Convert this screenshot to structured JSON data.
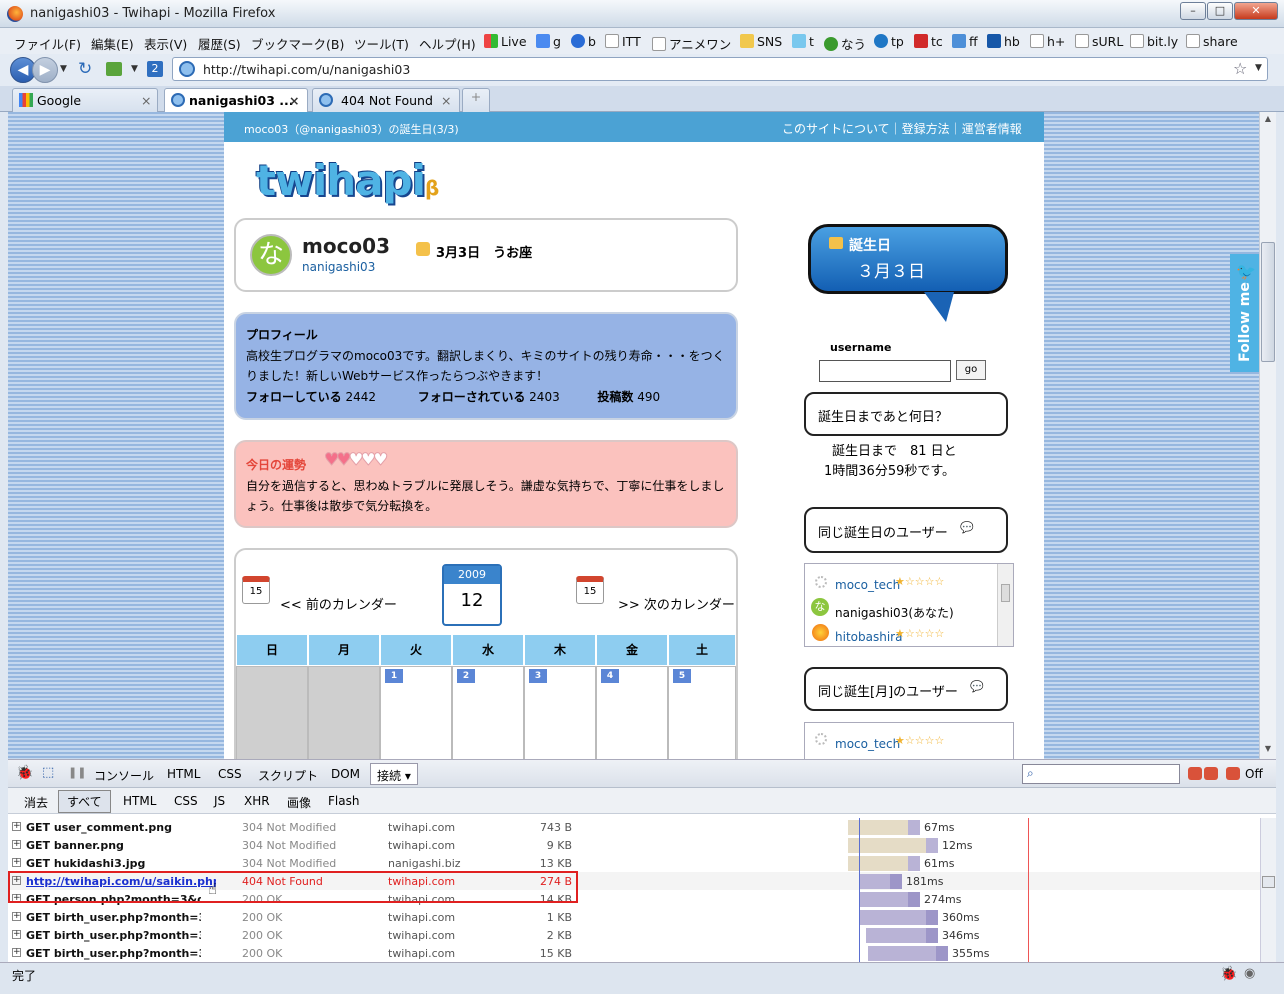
{
  "window": {
    "title": "nanigashi03 - Twihapi - Mozilla Firefox"
  },
  "menu": [
    "ファイル(F)",
    "編集(E)",
    "表示(V)",
    "履歴(S)",
    "ブックマーク(B)",
    "ツール(T)",
    "ヘルプ(H)"
  ],
  "bookmarks": [
    "Live",
    "g",
    "b",
    "ITT",
    "アニメワン",
    "SNS",
    "t",
    "なう",
    "tp",
    "tc",
    "ff",
    "hb",
    "h+",
    "sURL",
    "bit.ly",
    "share"
  ],
  "nav": {
    "url": "http://twihapi.com/u/nanigashi03"
  },
  "tabs": [
    {
      "label": "Google",
      "close": "×"
    },
    {
      "label": "nanigashi03 ...",
      "close": "×"
    },
    {
      "label": "404 Not Found",
      "close": "×"
    }
  ],
  "page": {
    "header_left": "moco03（@nanigashi03）の誕生日(3/3)",
    "header_links": [
      "このサイトについて",
      "登録方法",
      "運営者情報"
    ],
    "logo": "twihapi",
    "logo_beta": "β",
    "user": {
      "name": "moco03",
      "handle": "nanigashi03",
      "avatar_char": "な",
      "birthday": "3月3日",
      "sign": "うお座"
    },
    "profile": {
      "heading": "プロフィール",
      "text": "高校生プログラマのmoco03です。翻訳しまくり、キミのサイトの残り寿命・・・をつくりました！新しいWebサービス作ったらつぶやきます！",
      "following_label": "フォローしている",
      "following": "2442",
      "followers_label": "フォローされている",
      "followers": "2403",
      "posts_label": "投稿数",
      "posts": "490"
    },
    "fortune": {
      "heading": "今日の運勢",
      "hearts_filled": 2,
      "hearts_total": 5,
      "text": "自分を過信すると、思わぬトラブルに発展しそう。謙虚な気持ちで、丁寧に仕事をしましょう。仕事後は散歩で気分転換を。"
    },
    "calendar": {
      "year": "2009",
      "month": "12",
      "prev_icon": "15",
      "next_icon": "15",
      "prev": "<< 前のカレンダー",
      "next": ">> 次のカレンダー",
      "weekdays": [
        "日",
        "月",
        "火",
        "水",
        "木",
        "金",
        "土"
      ],
      "days": [
        "1",
        "2",
        "3",
        "4",
        "5"
      ]
    },
    "sidebar": {
      "bubble_title": "誕生日",
      "bubble_date": "３月３日",
      "username_label": "username",
      "go": "go",
      "days_left_title": "誕生日まであと何日？",
      "days_left_line1": "誕生日まで　81 日と",
      "days_left_line2": "1時間36分59秒です。",
      "same_day_title": "同じ誕生日のユーザー",
      "same_day_users": [
        "moco_tech",
        "nanigashi03(あなた)",
        "hitobashira"
      ],
      "same_month_title": "同じ誕生[月]のユーザー",
      "same_month_users": [
        "moco_tech"
      ],
      "follow_me": "Follow me"
    }
  },
  "firebug": {
    "tabs": [
      "コンソール",
      "HTML",
      "CSS",
      "スクリプト",
      "DOM",
      "接続 ▾"
    ],
    "filters": [
      "消去",
      "すべて",
      "HTML",
      "CSS",
      "JS",
      "XHR",
      "画像",
      "Flash"
    ],
    "off": "Off",
    "rows": [
      {
        "req": "GET user_comment.png",
        "status": "304 Not Modified",
        "domain": "twihapi.com",
        "size": "743 B",
        "time": "67ms"
      },
      {
        "req": "GET banner.png",
        "status": "304 Not Modified",
        "domain": "twihapi.com",
        "size": "9 KB",
        "time": "12ms"
      },
      {
        "req": "GET hukidashi3.jpg",
        "status": "304 Not Modified",
        "domain": "nanigashi.biz",
        "size": "13 KB",
        "time": "61ms"
      },
      {
        "req": "http://twihapi.com/u/saikin.php",
        "status": "404 Not Found",
        "domain": "twihapi.com",
        "size": "274 B",
        "time": "181ms"
      },
      {
        "req": "GET person.php?month=3&da",
        "status": "200 OK",
        "domain": "twihapi.com",
        "size": "14 KB",
        "time": "274ms"
      },
      {
        "req": "GET birth_user.php?month=3&",
        "status": "200 OK",
        "domain": "twihapi.com",
        "size": "1 KB",
        "time": "360ms"
      },
      {
        "req": "GET birth_user.php?month=3&",
        "status": "200 OK",
        "domain": "twihapi.com",
        "size": "2 KB",
        "time": "346ms"
      },
      {
        "req": "GET birth_user.php?month=3&",
        "status": "200 OK",
        "domain": "twihapi.com",
        "size": "15 KB",
        "time": "355ms"
      }
    ]
  },
  "status": {
    "text": "完了"
  }
}
